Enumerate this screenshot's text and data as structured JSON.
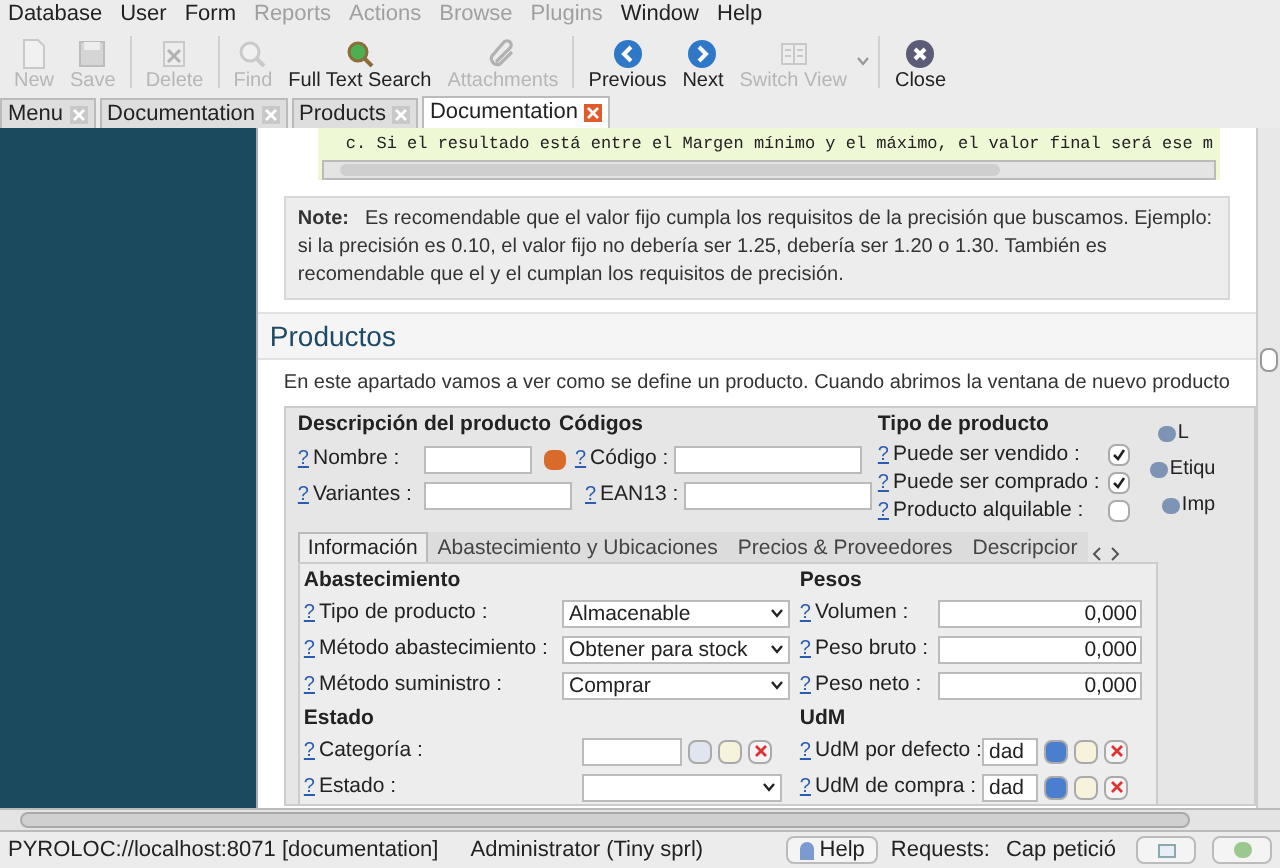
{
  "menu": [
    {
      "label": "Database",
      "disabled": false
    },
    {
      "label": "User",
      "disabled": false
    },
    {
      "label": "Form",
      "disabled": false
    },
    {
      "label": "Reports",
      "disabled": true
    },
    {
      "label": "Actions",
      "disabled": true
    },
    {
      "label": "Browse",
      "disabled": true
    },
    {
      "label": "Plugins",
      "disabled": true
    },
    {
      "label": "Window",
      "disabled": false
    },
    {
      "label": "Help",
      "disabled": false
    }
  ],
  "toolbar": [
    {
      "label": "New",
      "disabled": true
    },
    {
      "label": "Save",
      "disabled": true
    },
    {
      "label": "Delete",
      "disabled": true
    },
    {
      "label": "Find",
      "disabled": true
    },
    {
      "label": "Full Text Search",
      "disabled": false
    },
    {
      "label": "Attachments",
      "disabled": true
    },
    {
      "label": "Previous",
      "disabled": false
    },
    {
      "label": "Next",
      "disabled": false
    },
    {
      "label": "Switch View",
      "disabled": true
    },
    {
      "label": "Close",
      "disabled": false
    }
  ],
  "tabs": [
    {
      "label": "Menu",
      "selected": false
    },
    {
      "label": "Documentation",
      "selected": false
    },
    {
      "label": "Products",
      "selected": false
    },
    {
      "label": "Documentation",
      "selected": true
    }
  ],
  "doc": {
    "code_line": "c. Si el resultado está entre el Margen mínimo y el máximo, el valor final será ese m",
    "note": {
      "label": "Note:",
      "text": "Es recomendable que el valor fijo cumpla los requisitos de la precisión que buscamos. Ejemplo: si la precisión es 0.10, el valor fijo no debería ser 1.25, debería ser 1.20 o 1.30. También es recomendable que el y el cumplan los requisitos de precisión."
    },
    "heading": "Productos",
    "paragraph": "En este apartado vamos a ver como se define un producto. Cuando abrimos la ventana de nuevo producto",
    "product_form": {
      "section_1": "Descripción del producto",
      "section_2": "Códigos",
      "section_3": "Tipo de producto",
      "fields": [
        {
          "help": "?",
          "label": "Nombre :"
        },
        {
          "help": "?",
          "label": "Código :"
        },
        {
          "help": "?",
          "label": "Variantes :"
        },
        {
          "help": "?",
          "label": "EAN13 :"
        }
      ],
      "checks": [
        {
          "help": "?",
          "label": "Puede ser vendido :",
          "checked": true
        },
        {
          "help": "?",
          "label": "Puede ser comprado :",
          "checked": true
        },
        {
          "help": "?",
          "label": "Producto alquilable :",
          "checked": false
        }
      ],
      "side_actions": [
        "L",
        "Etiqu",
        "Imp"
      ],
      "tabs": [
        {
          "label": "Información",
          "selected": true
        },
        {
          "label": "Abastecimiento y Ubicaciones",
          "selected": false
        },
        {
          "label": "Precios & Proveedores",
          "selected": false
        },
        {
          "label": "Descripcior",
          "selected": false
        }
      ],
      "group_1": "Abastecimiento",
      "selects": [
        {
          "help": "?",
          "label": "Tipo de producto :",
          "value": "Almacenable"
        },
        {
          "help": "?",
          "label": "Método abastecimiento :",
          "value": "Obtener para stock"
        },
        {
          "help": "?",
          "label": "Método suministro :",
          "value": "Comprar"
        }
      ],
      "group_2": "Pesos",
      "weights": [
        {
          "help": "?",
          "label": "Volumen :",
          "value": "0,000"
        },
        {
          "help": "?",
          "label": "Peso bruto :",
          "value": "0,000"
        },
        {
          "help": "?",
          "label": "Peso neto :",
          "value": "0,000"
        }
      ],
      "group_3": "Estado",
      "group_4": "UdM",
      "categoria": {
        "help": "?",
        "label": "Categoría :"
      },
      "estado": {
        "help": "?",
        "label": "Estado :"
      },
      "uom": [
        {
          "help": "?",
          "label": "UdM por defecto :",
          "value": "dad"
        },
        {
          "help": "?",
          "label": "UdM de compra :",
          "value": "dad"
        }
      ]
    }
  },
  "status_bar": {
    "connection": "PYROLOC://localhost:8071 [documentation]",
    "user": "Administrator (Tiny sprl)",
    "help": "Help",
    "requests_label": "Requests:",
    "requests_value": "Cap petició"
  }
}
